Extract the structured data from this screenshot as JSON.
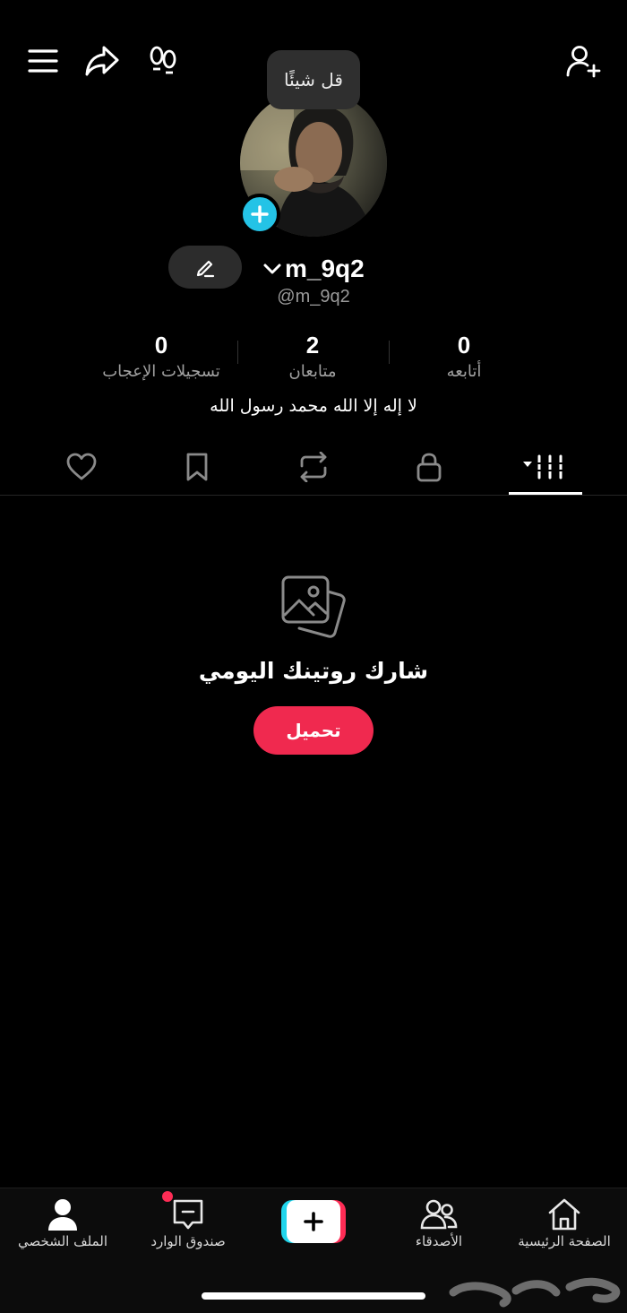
{
  "tooltip": {
    "text": "قل شيئًا"
  },
  "profile": {
    "username": "m_9q2",
    "handle": "@m_9q2",
    "bio": "لا إله إلا الله محمد رسول الله"
  },
  "stats": {
    "likes": {
      "value": "0",
      "label": "تسجيلات الإعجاب"
    },
    "followers": {
      "value": "2",
      "label": "متابعان"
    },
    "following": {
      "value": "0",
      "label": "أتابعه"
    }
  },
  "tabs": [
    "liked",
    "saved",
    "reposts",
    "private",
    "videos"
  ],
  "active_tab": "videos",
  "empty_state": {
    "title": "شارك روتينك اليومي",
    "button": "تحميل"
  },
  "bottom_nav": {
    "home": "الصفحة الرئيسية",
    "friends": "الأصدقاء",
    "inbox": "صندوق الوارد",
    "profile": "الملف الشخصي"
  },
  "colors": {
    "accent_red": "#fe2c55",
    "accent_cyan": "#20d5ec",
    "upload_button": "#f0294f"
  },
  "icons": [
    "menu-icon",
    "share-icon",
    "footprint-icon",
    "add-friend-icon",
    "edit-icon",
    "chevron-down-icon",
    "heart-icon",
    "bookmark-icon",
    "repost-icon",
    "lock-icon",
    "grid-icon",
    "photo-icon",
    "home-icon",
    "friends-icon",
    "inbox-icon",
    "profile-icon"
  ]
}
